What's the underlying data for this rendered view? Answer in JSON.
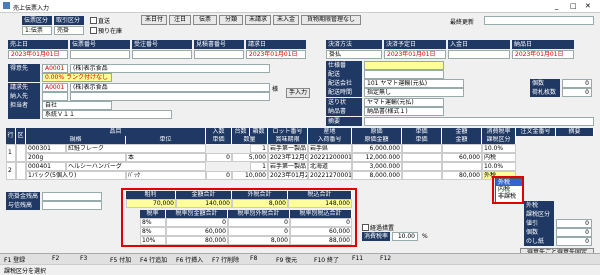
{
  "window": {
    "title": "売上伝票入力",
    "controls": [
      "_",
      "□",
      "✕"
    ]
  },
  "header_labels": {
    "denpyo_kubun": "伝票区分",
    "torihiki_kubun": "取引区分",
    "chokuso": "直送",
    "azukari": "預り在庫",
    "saishu_koushin": "最終更新"
  },
  "header_values": {
    "denpyo_kubun": "1:伝票",
    "torihiki_kubun": "売掛"
  },
  "top_buttons": [
    "未日付",
    "注日",
    "伝票",
    "分類",
    "未請求",
    "未入金",
    "貨物期限管理なし"
  ],
  "date_row": {
    "uriagebi_label": "売上日",
    "uriagebi_value": "2023年01月01日",
    "denpyo_no_label": "伝票番号",
    "juchu_no_label": "受注番号",
    "mitsumori_no_label": "見積書番号",
    "seikyu_label": "請求日",
    "seikyu_value": "2023年01月01日"
  },
  "customer": {
    "tokuisaki_label": "得意先",
    "tokuisaki_code": "A0001",
    "tokuisaki_name": "(株)表示食品",
    "rank": "0.00% ランク付けなし",
    "seikyusaki_label": "請求先",
    "seikyusaki_code": "A0001",
    "seikyusaki_name": "(株)表示食品",
    "nonyusaki_label": "納入先",
    "tantosha_label": "担当者",
    "tantosha_value": "自社",
    "tantosha_name": "系統Ｖ１１",
    "genba_label": "様",
    "tenyuryoku": "手入力"
  },
  "right_panel": {
    "kessai_label": "決済方法",
    "kessai_yotei_label": "決済予定日",
    "nyukin_label": "入金日",
    "nohin_label": "納品日",
    "kessai_value": "掛払",
    "kessai_yotei_value": "2023年01月01日",
    "nohin_value": "2023年01月01日",
    "kamoku_label": "仕様番",
    "haiso_label": "配送",
    "haiso_company_label": "配送会社",
    "haiso_company_value": "101 ヤマト運輸(元払)",
    "haiso_method_label": "配送時間",
    "haiso_method_value": "指定無し",
    "kosu_label": "個数",
    "kosu_value": "0",
    "niokuri_label": "荷札枚数",
    "niokuri_value": "0",
    "okurijo_label": "送り状",
    "okurijo_value": "ヤマト運輸(元払)",
    "hatsu_label": "納品書",
    "hatsu_value": "納品書(様式１)",
    "biko_label": "摘要"
  },
  "grid": {
    "headers_top": [
      "行",
      "区",
      "品目",
      "入数",
      "台数",
      "箱数",
      "ロット番号",
      "産地",
      "原価",
      "単価",
      "金額",
      "消費税率",
      "注文金番号",
      "摘要"
    ],
    "headers_bottom": [
      "規格",
      "単位",
      "単価",
      "数量",
      "賞味期限",
      "入荷番号",
      "原価金額",
      "単価",
      "金額",
      "課税区分"
    ],
    "rows": [
      {
        "no": "1",
        "code": "000301",
        "name": "紅鮭フレーク",
        "iri": "",
        "dai": "",
        "hako": "1",
        "lot": "岩手第一製品",
        "sanchi": "岩手県",
        "genka": "6,000.000",
        "tanka": "",
        "kingaku": "",
        "zeiritsu": "10.0%"
      },
      {
        "no": "",
        "code": "200g",
        "name": "本",
        "iri": "0",
        "dai": "5,000",
        "hako": "",
        "lot": "2023年12月08日",
        "sanchi": "20221200001",
        "genka": "12,000.000",
        "tanka": "",
        "kingaku": "60,000",
        "zeiritsu": "内税"
      },
      {
        "no": "2",
        "code": "000401",
        "name": "ヘルシーハンバーグ",
        "iri": "",
        "dai": "",
        "hako": "1",
        "lot": "岩手第一製品",
        "sanchi": "北海道",
        "genka": "3,000.000",
        "tanka": "",
        "kingaku": "",
        "zeiritsu": "10.0%"
      },
      {
        "no": "",
        "code": "1パック(5個入り)",
        "name": "ﾊﾟｯｸ",
        "iri": "0",
        "dai": "10,000",
        "hako": "",
        "lot": "2023年01月22日",
        "sanchi": "20221270001",
        "genka": "8,000.000",
        "tanka": "",
        "kingaku": "80,000",
        "zeiritsu": "外税"
      },
      {
        "no": "",
        "code": "",
        "name": "",
        "iri": "",
        "dai": "",
        "hako": "",
        "lot": "",
        "sanchi": "",
        "genka": "",
        "tanka": "",
        "kingaku": "",
        "zeiritsu": ""
      }
    ]
  },
  "tax_dropdown": {
    "options": [
      "外税",
      "内税",
      "非課税"
    ],
    "selected": "外税"
  },
  "summary": {
    "uriage_label": "売掛金残高",
    "zandaka_label": "与信残高",
    "headers": [
      "粗利",
      "金額合計",
      "外税合計",
      "税込合計"
    ],
    "values": [
      "70,000",
      "140,000",
      "8,000",
      "148,000"
    ],
    "tax_headers": [
      "税率",
      "税率別金額合計",
      "税率別外税合計",
      "税率別税込合計"
    ],
    "tax_rows": [
      {
        "rate": "8%",
        "amount": "0",
        "tax": "0",
        "total": "0"
      },
      {
        "rate": "8%",
        "amount": "60,000",
        "tax": "0",
        "total": "60,000"
      },
      {
        "rate": "10%",
        "amount": "80,000",
        "tax": "8,000",
        "total": "88,000"
      }
    ]
  },
  "right_bottom": {
    "gaizei_label": "外税",
    "tax_type_label": "消費税率",
    "tax_type_value": "10.00",
    "keigen_label": "経過措置",
    "kazei_label": "課税区分",
    "nebiki_label": "値引",
    "nebiki_value": "0",
    "kosu_label": "個数",
    "kosu_value": "0",
    "nokori_label": "のし紙",
    "nokori_value": "0",
    "ukeharai_label": "仕切",
    "unit_sign": "%",
    "otherinfo_button": "仕様表示内訳",
    "recent_button": "得意先ごと得意先固定"
  },
  "fkeys": [
    "F1 登録",
    "F2",
    "F3",
    "F4 行追加",
    "F5 付加",
    "F6 行挿入",
    "F7 行削除",
    "F8",
    "F9 復元",
    "F10 終了",
    "F11",
    "F12"
  ],
  "status": "課税区分を選択",
  "colors": {
    "header_bg": "#1f3864",
    "highlight": "#e00000",
    "field_yellow": "#ffff99"
  }
}
